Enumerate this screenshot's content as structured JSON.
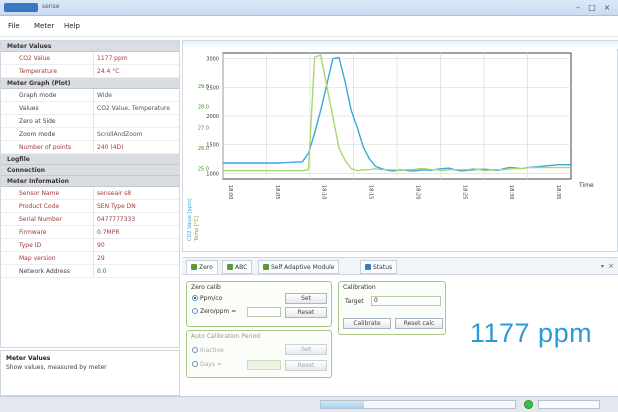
{
  "window": {
    "title": "sense"
  },
  "menu": {
    "items": [
      "File",
      "Meter",
      "Help"
    ]
  },
  "properties": {
    "sections": [
      {
        "title": "Meter Values",
        "rows": [
          {
            "key": "CO2 Value",
            "value": "1177 ppm",
            "red": true
          },
          {
            "key": "Temperature",
            "value": "24.4 °C",
            "red": true
          }
        ]
      },
      {
        "title": "Meter Graph (Plot)",
        "rows": [
          {
            "key": "Graph mode",
            "value": "Wide",
            "red": false
          },
          {
            "key": "Values",
            "value": "CO2 Value, Temperature",
            "red": false
          },
          {
            "key": "Zero at Side",
            "value": "",
            "red": false
          },
          {
            "key": "Zoom mode",
            "value": "ScrollAndZoom",
            "red": false
          },
          {
            "key": "Number of points",
            "value": "240 (4D)",
            "red": true
          }
        ]
      },
      {
        "title": "Logfile",
        "rows": []
      },
      {
        "title": "Connection",
        "rows": []
      },
      {
        "title": "Meter Information",
        "rows": [
          {
            "key": "Sensor Name",
            "value": "senseair s8",
            "red": true
          },
          {
            "key": "Product Code",
            "value": "SEN Type DN",
            "red": true
          },
          {
            "key": "Serial Number",
            "value": "0477777333",
            "red": true
          },
          {
            "key": "Firmware",
            "value": "0.7MPR",
            "red": true
          },
          {
            "key": "Type ID",
            "value": "90",
            "red": true
          },
          {
            "key": "Map version",
            "value": "29",
            "red": true
          },
          {
            "key": "Network Address",
            "value": "0.0",
            "red": false
          }
        ]
      }
    ]
  },
  "description": {
    "title": "Meter Values",
    "text": "Show values, measured by meter"
  },
  "chart_data": {
    "type": "line",
    "series": [
      {
        "name": "CO2 Value [ppm]",
        "color": "#3ba7dc",
        "values": [
          1180,
          1180,
          1180,
          1180,
          1180,
          1180,
          1180,
          1180,
          1180,
          1180,
          1185,
          1190,
          1195,
          1200,
          1350,
          1700,
          2100,
          2550,
          3000,
          3020,
          2600,
          2100,
          1800,
          1450,
          1250,
          1120,
          1080,
          1050,
          1040,
          1060,
          1050,
          1040,
          1050,
          1060,
          1050,
          1070,
          1080,
          1090,
          1060,
          1040,
          1050,
          1060,
          1070,
          1070,
          1060,
          1050,
          1080,
          1100,
          1090,
          1080,
          1100,
          1110,
          1120,
          1130,
          1140,
          1150,
          1150,
          1150
        ]
      },
      {
        "name": "Temp [°C]",
        "color": "#a9d86e",
        "values": [
          24.9,
          24.9,
          24.9,
          24.9,
          24.9,
          24.9,
          24.9,
          24.9,
          24.9,
          24.9,
          24.9,
          24.9,
          24.9,
          24.9,
          24.95,
          30.4,
          30.5,
          29.0,
          27.5,
          26.0,
          25.4,
          25.0,
          24.9,
          24.95,
          24.95,
          25.0,
          24.95,
          24.95,
          24.95,
          24.9,
          24.95,
          24.95,
          25.0,
          25.0,
          24.95,
          24.95,
          24.9,
          24.95,
          24.95,
          24.95,
          24.95,
          25.0,
          24.95,
          24.9,
          24.95,
          24.95,
          24.95,
          25.0,
          25.0,
          25.0,
          25.05,
          25.05,
          25.05,
          25.05,
          25.05,
          25.05,
          25.05,
          25.05
        ]
      }
    ],
    "y_left": {
      "label": "CO2 Value [ppm]",
      "ticks": [
        "1000",
        "1500",
        "2000",
        "2500",
        "3000"
      ],
      "range": [
        900,
        3100
      ]
    },
    "y_right": {
      "label": "Temp [°C]",
      "ticks": [
        "25.0",
        "26.0",
        "27.0",
        "28.0",
        "29.0"
      ],
      "range": [
        24.5,
        30.6
      ]
    },
    "x_label": "Time",
    "x_ticks": [
      "18:00",
      "18:05",
      "18:10",
      "18:15",
      "18:20",
      "18:25",
      "18:30",
      "18:35"
    ],
    "grid": true,
    "legend": "left"
  },
  "tabs": [
    {
      "label": "Zero",
      "active": true
    },
    {
      "label": "ABC",
      "active": false
    },
    {
      "label": "Self Adaptive Module",
      "active": false
    },
    {
      "label": "Status",
      "active": false
    }
  ],
  "panel": {
    "ppm_group": {
      "title": "Zero calib",
      "opt1": "Ppm/co",
      "opt2": "Zero/ppm =",
      "btn1": "Set",
      "btn2": "Reset",
      "value": ""
    },
    "calibration": {
      "title": "Calibration",
      "target_label": "Target",
      "target_value": "0",
      "btn_calibrate": "Calibrate",
      "btn_reset": "Reset calc"
    },
    "auto_group": {
      "title": "Auto Calibration Period",
      "opt1": "Inactive",
      "opt2": "Days =",
      "btn1": "Set",
      "btn2": "Reset",
      "value": ""
    },
    "big_value": "1177 ppm"
  },
  "status": {
    "progress": 0.22
  }
}
